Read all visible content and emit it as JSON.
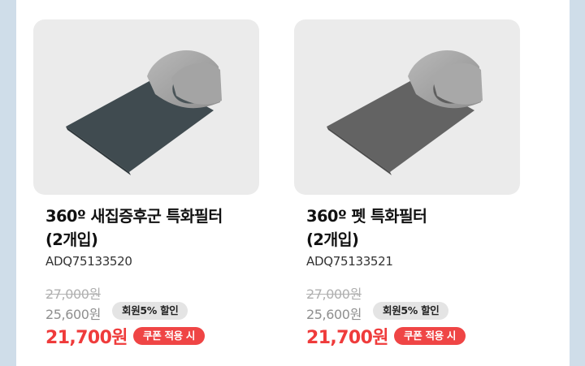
{
  "products": [
    {
      "title": "360º 새집증후군 특화필터\n(2개입)",
      "model": "ADQ75133520",
      "original_price": "27,000원",
      "member_price": "25,600원",
      "member_badge": "회원5% 할인",
      "coupon_price": "21,700원",
      "coupon_badge": "쿠폰 적용 시",
      "image_icon": "dark-grey-filter-roll-icon",
      "filter_color": "#404b50"
    },
    {
      "title": "360º 펫 특화필터\n(2개입)",
      "model": "ADQ75133521",
      "original_price": "27,000원",
      "member_price": "25,600원",
      "member_badge": "회원5% 할인",
      "coupon_price": "21,700원",
      "coupon_badge": "쿠폰 적용 시",
      "image_icon": "grey-filter-roll-icon",
      "filter_color": "#636363"
    }
  ],
  "colors": {
    "accent_price": "#ef3b3b",
    "coupon_badge_bg": "#ef4545",
    "member_badge_bg": "#e4e4e4",
    "page_bg": "#cfdde9"
  }
}
